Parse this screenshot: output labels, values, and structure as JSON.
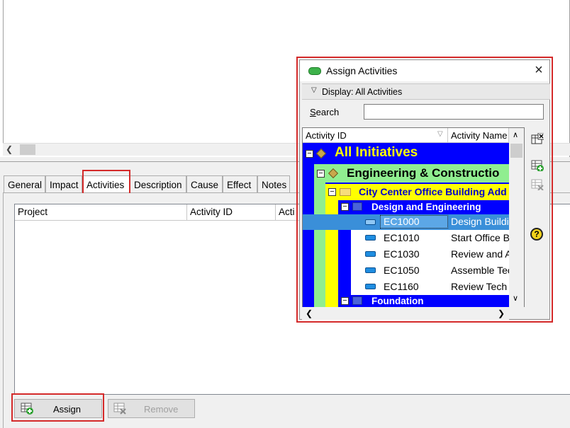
{
  "tabs": [
    "General",
    "Impact",
    "Activities",
    "Description",
    "Cause",
    "Effect",
    "Notes"
  ],
  "grid": {
    "columns": [
      "Project",
      "Activity ID",
      "Acti"
    ]
  },
  "buttons": {
    "assign": "Assign",
    "remove": "Remove"
  },
  "dialog": {
    "title": "Assign Activities",
    "close": "×",
    "display_label": "Display: All Activities",
    "search_label": "Search",
    "search_value": "",
    "columns": [
      "Activity ID",
      "Activity Name"
    ],
    "tree": [
      {
        "label": "All  Initiatives"
      },
      {
        "label": "Engineering & Constructio"
      },
      {
        "label": "City Center Office Building Add"
      },
      {
        "label": "Design and Engineering"
      },
      {
        "id": "EC1000",
        "name": "Design Buildin"
      },
      {
        "id": "EC1010",
        "name": "Start Office Bu"
      },
      {
        "id": "EC1030",
        "name": "Review and A"
      },
      {
        "id": "EC1050",
        "name": "Assemble Tec"
      },
      {
        "id": "EC1160",
        "name": "Review Tech"
      },
      {
        "label": "Foundation"
      }
    ],
    "help": "?"
  },
  "colors": {
    "highlight": "#d42a2a",
    "tree_bg": "#0000ff",
    "level1": "#ffff00",
    "level2": "#90ee90",
    "selected": "#3a8fd9"
  }
}
